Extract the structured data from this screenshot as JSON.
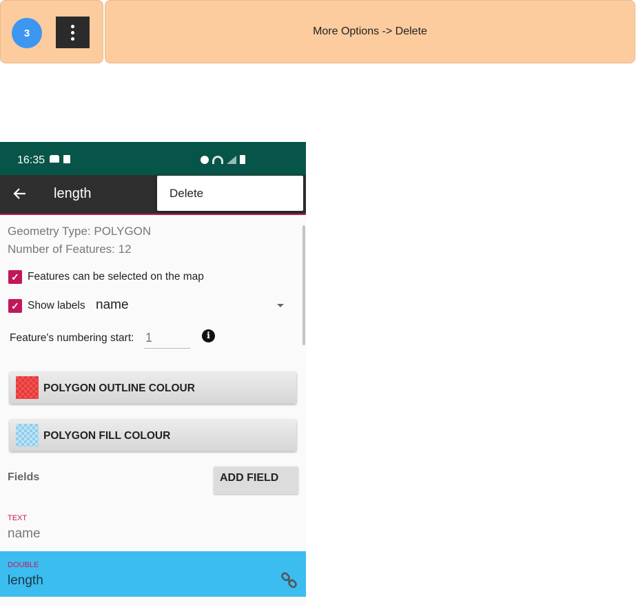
{
  "step": {
    "number": "3",
    "icon": "more-vert-icon",
    "instruction": "More Options -> Delete"
  },
  "status_bar": {
    "time": "16:35",
    "left_icons": [
      "car-icon",
      "sd-card-icon"
    ],
    "right_icons": [
      "alarm-icon",
      "wifi-icon",
      "signal-icon",
      "battery-icon"
    ],
    "color": "#075548"
  },
  "toolbar": {
    "title": "length",
    "back_icon": "arrow-back-icon",
    "accent": "#c2185b"
  },
  "menu": {
    "items": [
      {
        "label": "Delete"
      }
    ]
  },
  "layer_info": {
    "geometry_type": "Geometry Type: POLYGON",
    "num_features": "Number of Features: 12"
  },
  "options": {
    "selectable": {
      "label": "Features can be selected on the map",
      "checked": true
    },
    "show_labels": {
      "label": "Show labels",
      "checked": true,
      "selected_field": "name"
    },
    "numbering": {
      "label": "Feature's numbering start:",
      "placeholder": "1"
    }
  },
  "buttons": {
    "outline_colour": "POLYGON OUTLINE COLOUR",
    "fill_colour": "POLYGON FILL COLOUR",
    "add_field": "ADD FIELD"
  },
  "fields": {
    "title": "Fields",
    "items": [
      {
        "type": "TEXT",
        "name": "name",
        "selected": false
      },
      {
        "type": "DOUBLE",
        "name": "length",
        "selected": true
      }
    ]
  }
}
